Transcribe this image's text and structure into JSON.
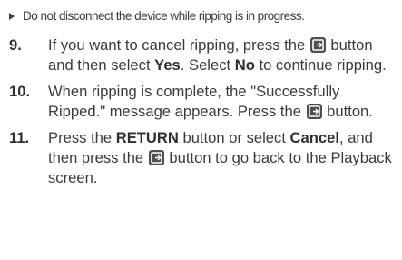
{
  "note": {
    "text": "Do not disconnect the device while ripping is in progress."
  },
  "icons": {
    "enter_button": "enter-button-icon",
    "bullet": "triangle-bullet-icon"
  },
  "steps": [
    {
      "number": "9.",
      "p1": "If you want to cancel ripping, press the ",
      "p2": " button and then select ",
      "bold1": "Yes",
      "p3": ". Select ",
      "bold2": "No",
      "p4": " to continue ripping."
    },
    {
      "number": "10.",
      "p1": "When ripping is complete, the \"Successfully Ripped.\" message appears. Press the ",
      "p2": " button."
    },
    {
      "number": "11.",
      "p1": "Press the ",
      "bold1": "RETURN",
      "p2": " button or select ",
      "bold2": "Cancel",
      "p3": ", and then press the ",
      "p4": " button to go back to the Playback screen."
    }
  ]
}
